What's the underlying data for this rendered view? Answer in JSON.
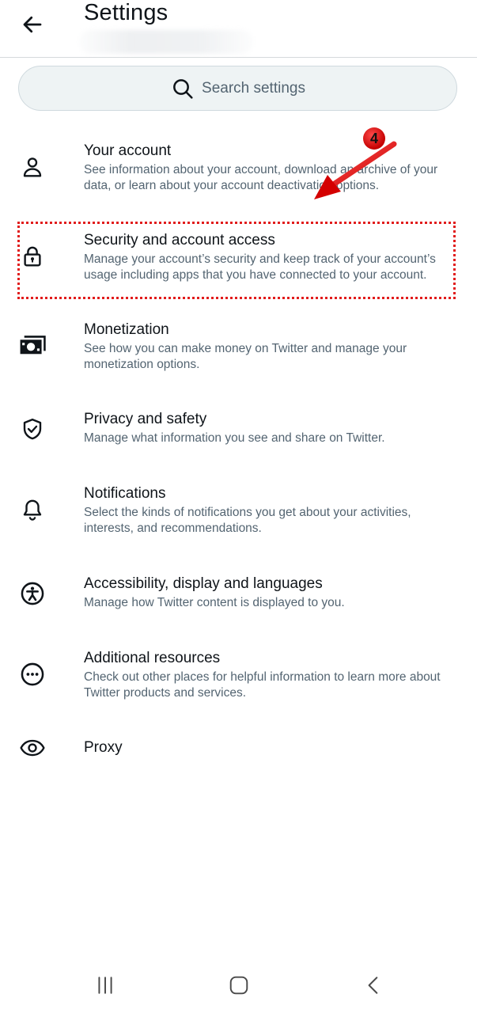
{
  "header": {
    "title": "Settings"
  },
  "search": {
    "placeholder": "Search settings"
  },
  "items": [
    {
      "label": "Your account",
      "description": "See information about your account, download an archive of your data, or learn about your account deactivation options.",
      "icon": "person-icon"
    },
    {
      "label": "Security and account access",
      "description": "Manage your account’s security and keep track of your account’s usage including apps that you have connected to your account.",
      "icon": "lock-icon"
    },
    {
      "label": "Monetization",
      "description": "See how you can make money on Twitter and manage your monetization options.",
      "icon": "money-icon"
    },
    {
      "label": "Privacy and safety",
      "description": "Manage what information you see and share on Twitter.",
      "icon": "shield-check-icon"
    },
    {
      "label": "Notifications",
      "description": "Select the kinds of notifications you get about your activities, interests, and recommendations.",
      "icon": "bell-icon"
    },
    {
      "label": "Accessibility, display and languages",
      "description": "Manage how Twitter content is displayed to you.",
      "icon": "accessibility-icon"
    },
    {
      "label": "Additional resources",
      "description": "Check out other places for helpful information to learn more about Twitter products and services.",
      "icon": "more-circle-icon"
    },
    {
      "label": "Proxy",
      "description": "",
      "icon": "eye-icon"
    }
  ],
  "annotation": {
    "step_number": "4",
    "color": "#e11c1c"
  },
  "colors": {
    "primary_text": "#0f1419",
    "secondary_text": "#536471",
    "search_bg": "#eef3f4"
  }
}
